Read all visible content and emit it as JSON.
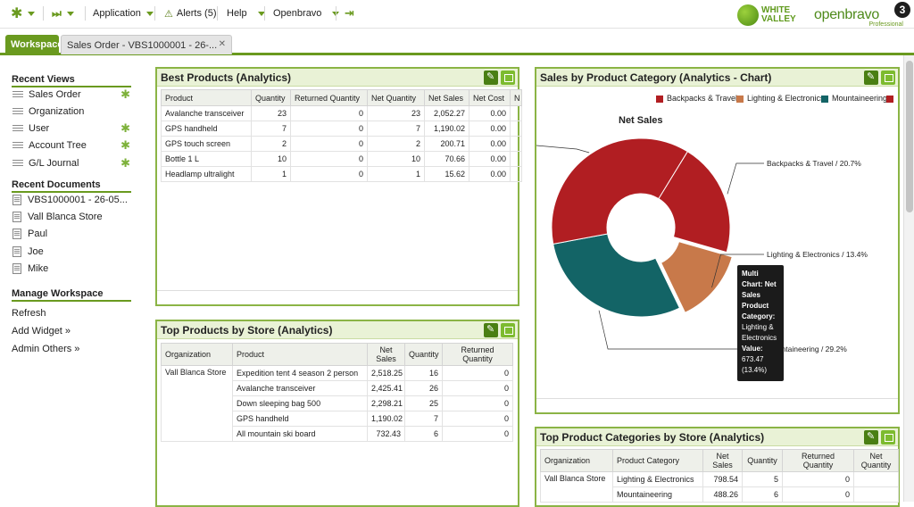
{
  "topbar": {
    "application": "Application",
    "alerts": "Alerts (5)",
    "help": "Help",
    "openbravo": "Openbravo"
  },
  "logos": {
    "white_valley": [
      "WHITE",
      "VALLEY"
    ],
    "openbravo": "openbravo",
    "version": "3",
    "edition": "Professional"
  },
  "tabs": {
    "workspace": "Workspace",
    "order": "Sales Order - VBS1000001 - 26-..."
  },
  "nav": {
    "recent_views_title": "Recent Views",
    "recent_views": [
      "Sales Order",
      "Organization",
      "User",
      "Account Tree",
      "G/L Journal"
    ],
    "recent_docs_title": "Recent Documents",
    "recent_docs": [
      "VBS1000001 - 26-05...",
      "Vall Blanca Store",
      "Paul",
      "Joe",
      "Mike"
    ],
    "manage_title": "Manage Workspace",
    "refresh": "Refresh",
    "add_widget": "Add Widget »",
    "admin_others": "Admin Others »"
  },
  "best_products": {
    "title": "Best Products (Analytics)",
    "headers": [
      "Product",
      "Quantity",
      "Returned Quantity",
      "Net Quantity",
      "Net Sales",
      "Net Cost",
      "N"
    ],
    "rows": [
      [
        "Avalanche transceiver",
        "23",
        "0",
        "23",
        "2,052.27",
        "0.00"
      ],
      [
        "GPS handheld",
        "7",
        "0",
        "7",
        "1,190.02",
        "0.00"
      ],
      [
        "GPS touch screen",
        "2",
        "0",
        "2",
        "200.71",
        "0.00"
      ],
      [
        "Bottle 1 L",
        "10",
        "0",
        "10",
        "70.66",
        "0.00"
      ],
      [
        "Headlamp ultralight",
        "1",
        "0",
        "1",
        "15.62",
        "0.00"
      ]
    ]
  },
  "top_products_store": {
    "title": "Top Products by Store (Analytics)",
    "headers": [
      "Organization",
      "Product",
      "Net Sales",
      "Quantity",
      "Returned Quantity"
    ],
    "organization": "Vall Blanca Store",
    "rows": [
      [
        "Expedition tent 4 season 2 person",
        "2,518.25",
        "16",
        "0"
      ],
      [
        "Avalanche transceiver",
        "2,425.41",
        "26",
        "0"
      ],
      [
        "Down sleeping bag 500",
        "2,298.21",
        "25",
        "0"
      ],
      [
        "GPS handheld",
        "1,190.02",
        "7",
        "0"
      ],
      [
        "All mountain ski board",
        "732.43",
        "6",
        "0"
      ]
    ]
  },
  "category_chart": {
    "title": "Sales by Product Category (Analytics - Chart)"
  },
  "chart_data": {
    "type": "pie",
    "variant": "donut",
    "title": "Net Sales",
    "legend": [
      "Backpacks & Travel",
      "Lighting & Electronics",
      "Mountaineering"
    ],
    "labels": [
      "Backpacks & Travel / 20.7%",
      "Lighting & Electronics / 13.4%",
      "Mountaineering / 29.2%"
    ],
    "series": [
      {
        "name": "Backpacks & Travel",
        "percent": 20.7,
        "color": "#b11e22"
      },
      {
        "name": "Lighting & Electronics",
        "percent": 13.4,
        "color": "#c8794a"
      },
      {
        "name": "Mountaineering",
        "percent": 29.2,
        "color": "#136466"
      },
      {
        "name": "",
        "percent": 36.7,
        "color": "#b11e22"
      }
    ]
  },
  "tooltip": {
    "lines": [
      "Multi",
      "Chart: Net",
      "Sales",
      "Product",
      "Category:",
      "Lighting &",
      "Electronics",
      "Value:",
      "673.47",
      "(13.4%)"
    ]
  },
  "top_categories_store": {
    "title": "Top Product Categories by Store (Analytics)",
    "headers": [
      "Organization",
      "Product Category",
      "Net Sales",
      "Quantity",
      "Returned Quantity",
      "Net Quantity"
    ],
    "organization": "Vall Blanca Store",
    "rows": [
      [
        "Lighting & Electronics",
        "798.54",
        "5",
        "0",
        ""
      ],
      [
        "Mountaineering",
        "488.26",
        "6",
        "0",
        ""
      ]
    ]
  },
  "colors": {
    "accent": "#6a9a1f",
    "widget_border": "#8bb445"
  }
}
